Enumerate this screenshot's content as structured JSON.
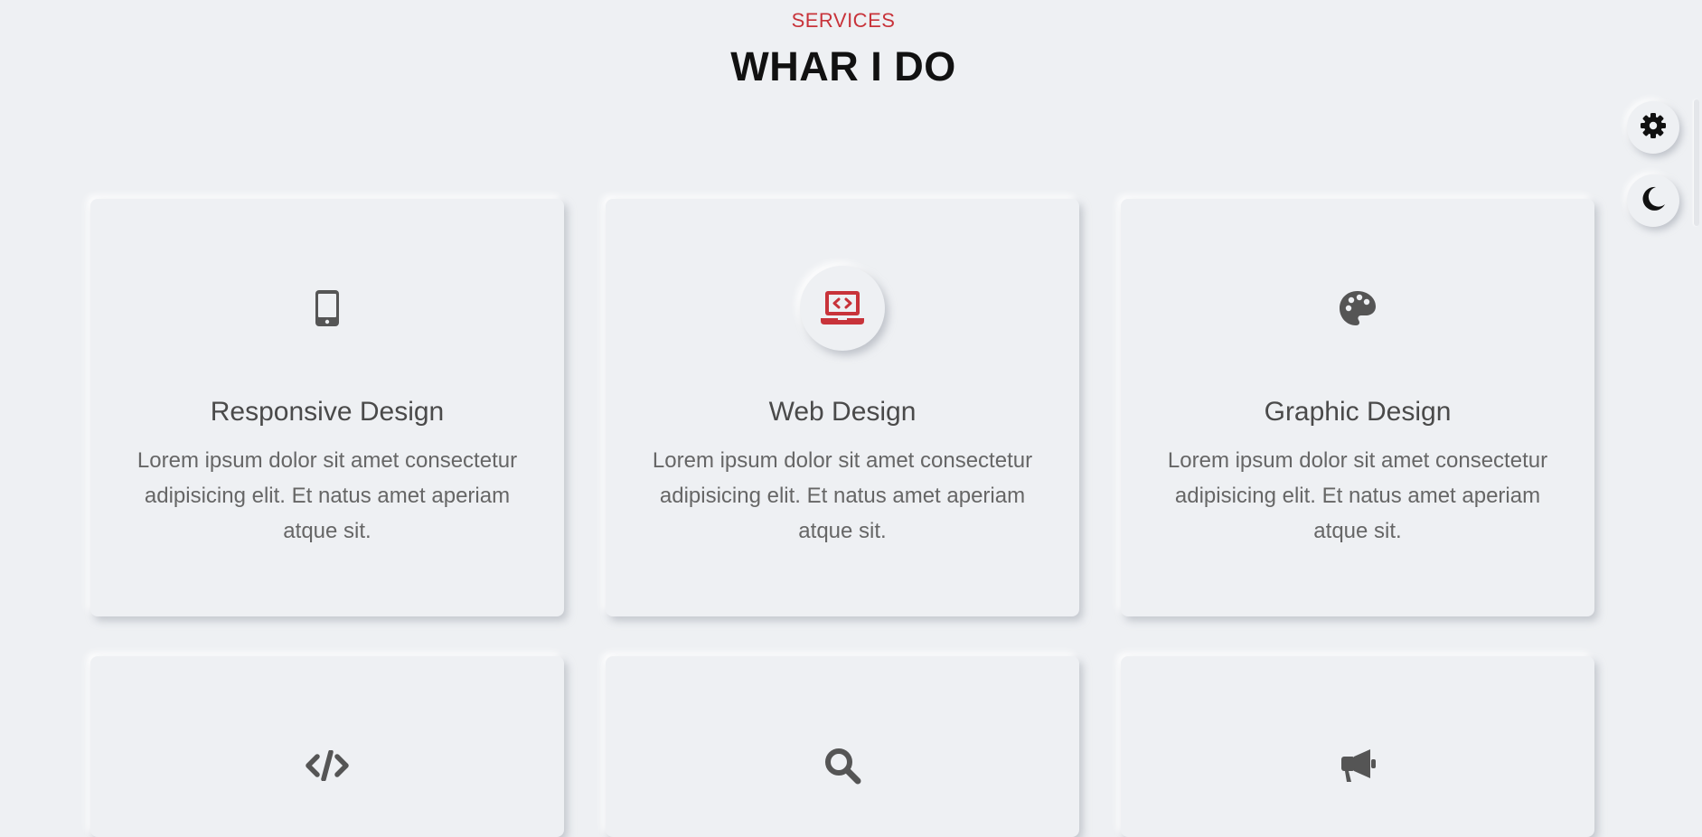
{
  "section": {
    "eyebrow": "SERVICES",
    "title": "WHAR I DO"
  },
  "colors": {
    "accent": "#c8333a",
    "background": "#eef0f3",
    "icon": "#555555",
    "title_text": "#111111",
    "card_title": "#4a4a4a",
    "card_text": "#666666"
  },
  "services": [
    {
      "icon": "mobile-icon",
      "title": "Responsive Design",
      "description": "Lorem ipsum dolor sit amet consectetur adipisicing elit. Et natus amet aperiam atque sit."
    },
    {
      "icon": "laptop-code-icon",
      "title": "Web Design",
      "description": "Lorem ipsum dolor sit amet consectetur adipisicing elit. Et natus amet aperiam atque sit.",
      "active": true
    },
    {
      "icon": "palette-icon",
      "title": "Graphic Design",
      "description": "Lorem ipsum dolor sit amet consectetur adipisicing elit. Et natus amet aperiam atque sit."
    },
    {
      "icon": "code-icon"
    },
    {
      "icon": "search-icon"
    },
    {
      "icon": "bullhorn-icon"
    }
  ],
  "controls": {
    "settings_icon": "gear-icon",
    "theme_icon": "moon-icon"
  }
}
